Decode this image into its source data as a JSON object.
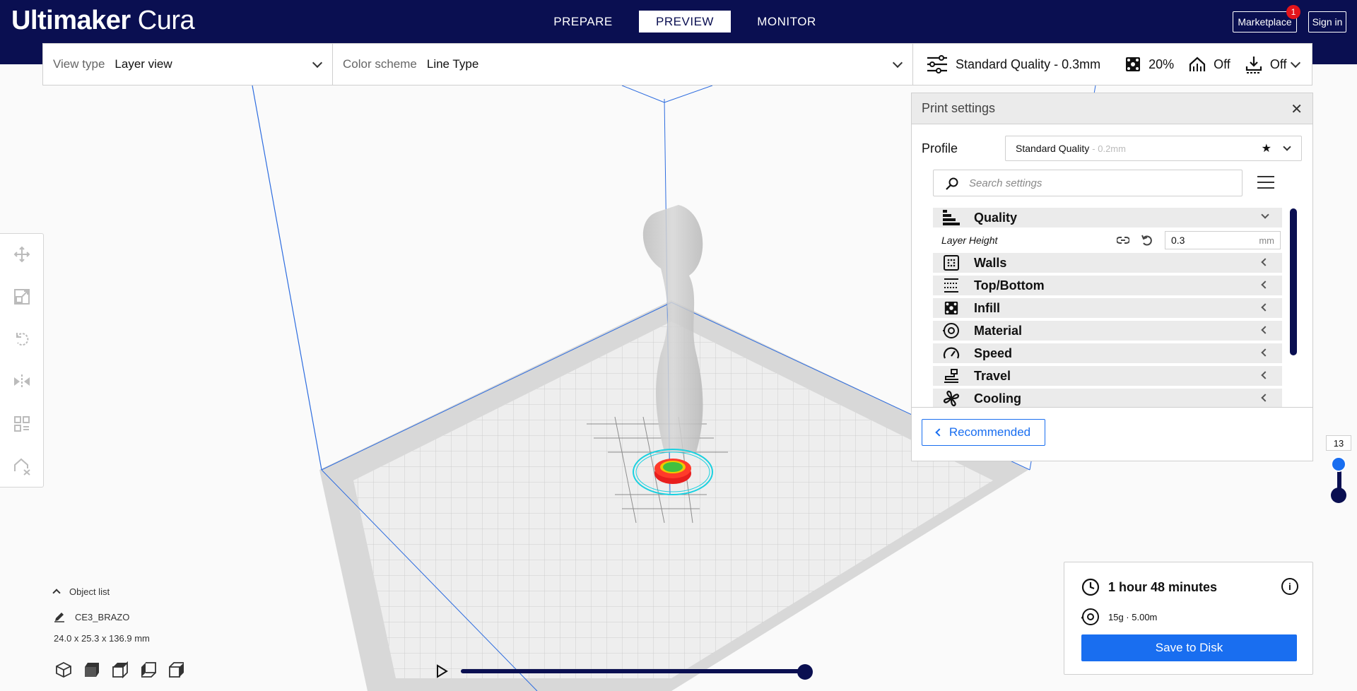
{
  "header": {
    "brand_bold": "Ultimaker",
    "brand_light": "Cura",
    "tabs": [
      {
        "label": "PREPARE"
      },
      {
        "label": "PREVIEW"
      },
      {
        "label": "MONITOR"
      }
    ],
    "active_tab": "PREVIEW",
    "marketplace_label": "Marketplace",
    "marketplace_badge": "1",
    "signin_label": "Sign in"
  },
  "toolbar": {
    "view_type_label": "View type",
    "view_type_value": "Layer view",
    "color_scheme_label": "Color scheme",
    "color_scheme_value": "Line Type",
    "quality_summary": "Standard Quality - 0.3mm",
    "infill_summary": "20%",
    "support_summary": "Off",
    "adhesion_summary": "Off"
  },
  "print_settings": {
    "title": "Print settings",
    "profile_label": "Profile",
    "profile_value": "Standard Quality",
    "profile_sub": "- 0.2mm",
    "search_placeholder": "Search settings",
    "categories": [
      {
        "label": "Quality",
        "icon": "quality-icon",
        "expanded": true
      },
      {
        "label": "Walls",
        "icon": "walls-icon"
      },
      {
        "label": "Top/Bottom",
        "icon": "top-bottom-icon"
      },
      {
        "label": "Infill",
        "icon": "infill-icon"
      },
      {
        "label": "Material",
        "icon": "material-icon"
      },
      {
        "label": "Speed",
        "icon": "speed-icon"
      },
      {
        "label": "Travel",
        "icon": "travel-icon"
      },
      {
        "label": "Cooling",
        "icon": "cooling-icon"
      }
    ],
    "layer_height": {
      "label": "Layer Height",
      "value": "0.3",
      "unit": "mm"
    },
    "recommended_label": "Recommended"
  },
  "layer_slider": {
    "current_layer": "13"
  },
  "object_list": {
    "title": "Object list",
    "object_name": "CE3_BRAZO",
    "dimensions": "24.0 x 25.3 x 136.9 mm"
  },
  "job": {
    "time": "1 hour 48 minutes",
    "material": "15g · 5.00m",
    "save_label": "Save to Disk"
  },
  "colors": {
    "header_bg": "#0a0f51",
    "accent_blue": "#196ef0",
    "badge_red": "#e3141b"
  }
}
